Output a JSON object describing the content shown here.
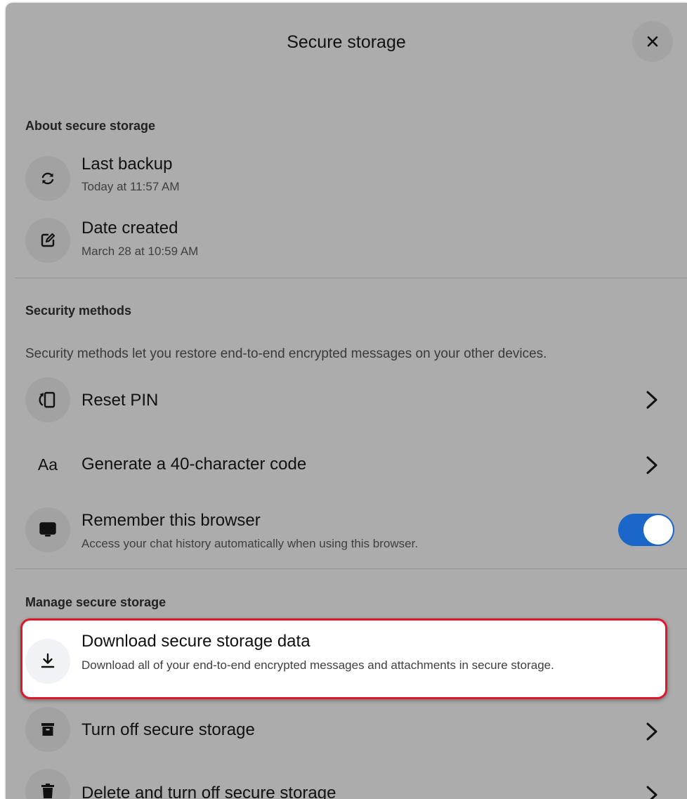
{
  "dialog": {
    "title": "Secure storage",
    "close_icon": "close-icon"
  },
  "about": {
    "heading": "About secure storage",
    "items": [
      {
        "title": "Last backup",
        "subtitle": "Today at 11:57 AM",
        "icon": "sync-icon"
      },
      {
        "title": "Date created",
        "subtitle": "March 28 at 10:59 AM",
        "icon": "edit-icon"
      }
    ]
  },
  "security": {
    "heading": "Security methods",
    "description": "Security methods let you restore end-to-end encrypted messages on your other devices.",
    "items": [
      {
        "title": "Reset PIN",
        "icon": "phone-reset-icon"
      },
      {
        "title": "Generate a 40-character code",
        "icon_text": "Aa"
      },
      {
        "title": "Remember this browser",
        "subtitle": "Access your chat history automatically when using this browser.",
        "icon": "monitor-icon",
        "toggle_on": true
      }
    ]
  },
  "manage": {
    "heading": "Manage secure storage",
    "items": [
      {
        "title": "Download secure storage data",
        "subtitle": "Download all of your end-to-end encrypted messages and attachments in secure storage.",
        "icon": "download-icon"
      },
      {
        "title": "Turn off secure storage",
        "icon": "archive-icon"
      },
      {
        "title": "Delete and turn off secure storage",
        "icon": "trash-icon"
      }
    ]
  },
  "colors": {
    "panel_bg": "#acacac",
    "toggle_on": "#1b67c9",
    "highlight_border": "#e0162b"
  }
}
